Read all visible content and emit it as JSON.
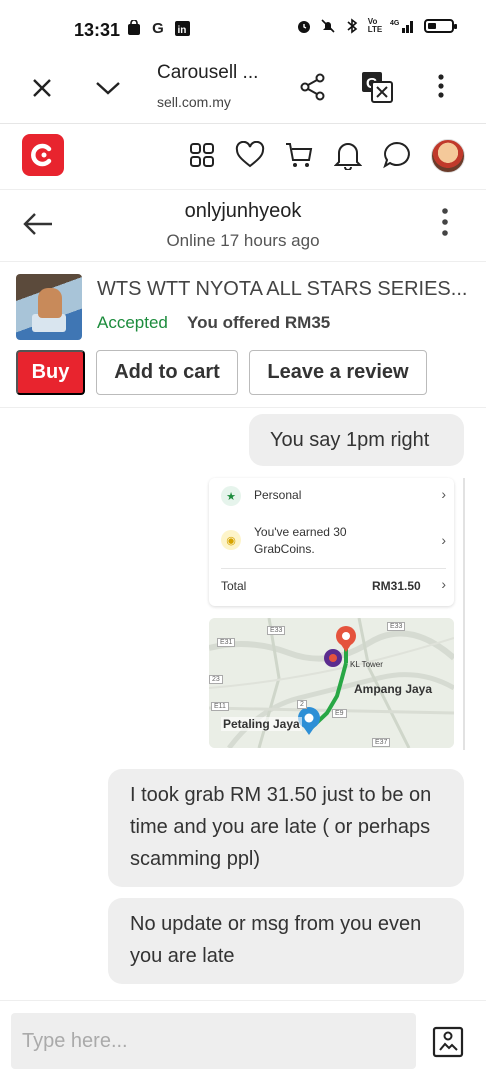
{
  "status": {
    "time": "13:31"
  },
  "browser": {
    "title": "Carousell ...",
    "url": "sell.com.my"
  },
  "chat": {
    "username": "onlyjunhyeok",
    "status": "Online 17 hours ago"
  },
  "listing": {
    "title": "WTS WTT NYOTA ALL STARS SERIES...",
    "status": "Accepted",
    "offer": "You offered RM35",
    "buy_label": "Buy",
    "cart_label": "Add to cart",
    "review_label": "Leave a review"
  },
  "messages": [
    {
      "text": "You say 1pm right"
    },
    {
      "text": "I took grab RM 31.50 just to be on time and you are late ( or perhaps scamming ppl)"
    },
    {
      "text": "No update or msg from you even you are late"
    }
  ],
  "attachment": {
    "receipt": {
      "personal": "Personal",
      "earned": "You've earned 30 GrabCoins.",
      "total_label": "Total",
      "total_value": "RM31.50"
    },
    "map": {
      "labels": [
        "KL Tower",
        "Ampang Jaya",
        "Petaling Jaya"
      ],
      "road_codes": [
        "E33",
        "E33",
        "E31",
        "23",
        "E11",
        "2",
        "E9",
        "E37"
      ]
    }
  },
  "input": {
    "placeholder": "Type here..."
  },
  "colors": {
    "brand": "#e8242e",
    "accepted": "#1c8c3c",
    "bubble": "#eeeeee"
  }
}
